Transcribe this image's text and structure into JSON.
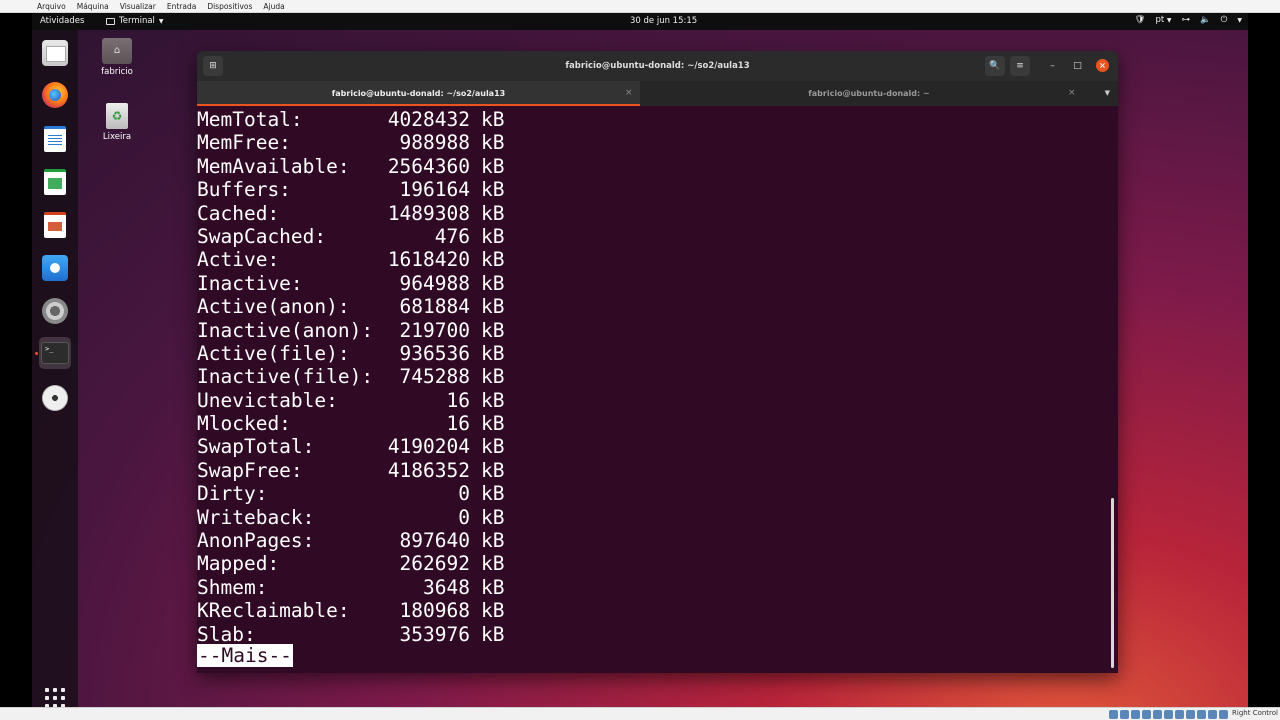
{
  "vbox_menu": [
    "Arquivo",
    "Máquina",
    "Visualizar",
    "Entrada",
    "Dispositivos",
    "Ajuda"
  ],
  "topbar": {
    "activities": "Atividades",
    "app_name": "Terminal",
    "clock": "30 de jun  15:15",
    "keyboard_layout": "pt"
  },
  "dock": {
    "items": [
      "files-icon",
      "firefox-icon",
      "libreoffice-writer-icon",
      "libreoffice-calc-icon",
      "libreoffice-impress-icon",
      "ubuntu-software-icon",
      "settings-icon",
      "terminal-icon",
      "dvd-icon"
    ],
    "active": "terminal-icon"
  },
  "desktop": {
    "home_label": "fabricio",
    "trash_label": "Lixeira"
  },
  "terminal": {
    "window_title": "fabricio@ubuntu-donald: ~/so2/aula13",
    "tabs": [
      {
        "label": "fabricio@ubuntu-donald: ~/so2/aula13",
        "active": true
      },
      {
        "label": "fabricio@ubuntu-donald: ~",
        "active": false
      }
    ],
    "meminfo": [
      {
        "key": "MemTotal:",
        "value": "4028432",
        "unit": "kB"
      },
      {
        "key": "MemFree:",
        "value": "988988",
        "unit": "kB"
      },
      {
        "key": "MemAvailable:",
        "value": "2564360",
        "unit": "kB"
      },
      {
        "key": "Buffers:",
        "value": "196164",
        "unit": "kB"
      },
      {
        "key": "Cached:",
        "value": "1489308",
        "unit": "kB"
      },
      {
        "key": "SwapCached:",
        "value": "476",
        "unit": "kB"
      },
      {
        "key": "Active:",
        "value": "1618420",
        "unit": "kB"
      },
      {
        "key": "Inactive:",
        "value": "964988",
        "unit": "kB"
      },
      {
        "key": "Active(anon):",
        "value": "681884",
        "unit": "kB"
      },
      {
        "key": "Inactive(anon):",
        "value": "219700",
        "unit": "kB"
      },
      {
        "key": "Active(file):",
        "value": "936536",
        "unit": "kB"
      },
      {
        "key": "Inactive(file):",
        "value": "745288",
        "unit": "kB"
      },
      {
        "key": "Unevictable:",
        "value": "16",
        "unit": "kB"
      },
      {
        "key": "Mlocked:",
        "value": "16",
        "unit": "kB"
      },
      {
        "key": "SwapTotal:",
        "value": "4190204",
        "unit": "kB"
      },
      {
        "key": "SwapFree:",
        "value": "4186352",
        "unit": "kB"
      },
      {
        "key": "Dirty:",
        "value": "0",
        "unit": "kB"
      },
      {
        "key": "Writeback:",
        "value": "0",
        "unit": "kB"
      },
      {
        "key": "AnonPages:",
        "value": "897640",
        "unit": "kB"
      },
      {
        "key": "Mapped:",
        "value": "262692",
        "unit": "kB"
      },
      {
        "key": "Shmem:",
        "value": "3648",
        "unit": "kB"
      },
      {
        "key": "KReclaimable:",
        "value": "180968",
        "unit": "kB"
      },
      {
        "key": "Slab:",
        "value": "353976",
        "unit": "kB"
      }
    ],
    "pager_prompt": "--Mais--"
  },
  "vbox_status": {
    "host_key": "Right Control"
  },
  "colors": {
    "terminal_bg": "#300a24",
    "ubuntu_orange": "#e95420"
  }
}
